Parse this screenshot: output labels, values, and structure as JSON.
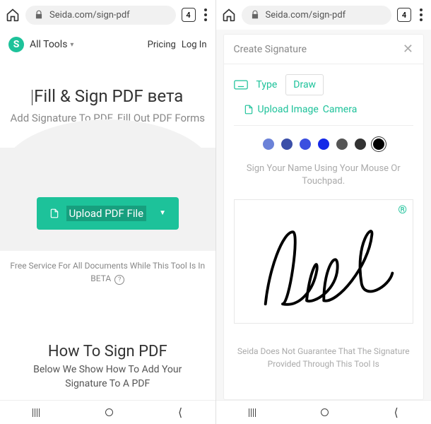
{
  "browser": {
    "url": "Seida.com/sign-pdf",
    "tab_count": "4"
  },
  "left": {
    "logo_letter": "S",
    "all_tools": "All Tools",
    "pricing": "Pricing",
    "login": "Log In",
    "title": "Fill & Sign PDF вета",
    "subtitle": "Add Signature To PDF. Fill Out PDF Forms",
    "upload_label": "Upload PDF File",
    "free_service": "Free Service For All Documents While This Tool Is In BETA",
    "info_symbol": "?",
    "howto_title": "How To Sign PDF",
    "howto_body": "Below We Show How To Add Your Signature To A PDF"
  },
  "right": {
    "modal_title": "Create Signature",
    "tab_type": "Type",
    "tab_draw": "Draw",
    "tab_upload": "Upload Image",
    "tab_camera": "Camera",
    "instruction": "Sign Your Name Using Your Mouse Or Touchpad.",
    "reg_mark": "®",
    "disclaimer": "Seida Does Not Guarantee That The Signature Provided Through This Tool Is",
    "colors": [
      "#6b82d8",
      "#3b4fa8",
      "#3b4fe0",
      "#1529e8",
      "#555555",
      "#333333",
      "#000000"
    ],
    "selected_color_index": 6
  }
}
